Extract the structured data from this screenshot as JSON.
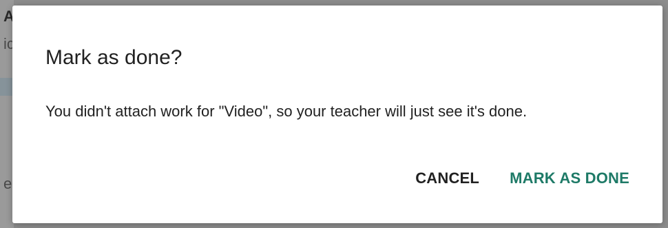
{
  "background": {
    "fragments": [
      "A",
      "ic",
      "e"
    ]
  },
  "dialog": {
    "title": "Mark as done?",
    "message": "You didn't attach work for \"Video\", so your teacher will just see it's done.",
    "cancel_label": "CANCEL",
    "confirm_label": "MARK AS DONE"
  },
  "colors": {
    "accent": "#1e7a67",
    "text": "#212121",
    "scrim": "#8c8c8c"
  }
}
